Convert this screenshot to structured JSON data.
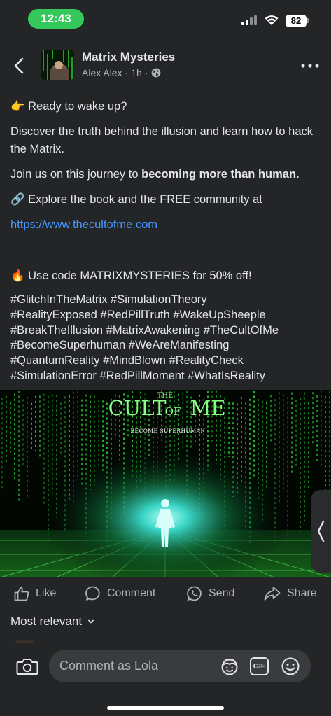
{
  "status_bar": {
    "time": "12:43",
    "battery": "82"
  },
  "header": {
    "page_name": "Matrix Mysteries",
    "author": "Alex Alex",
    "separator": "·",
    "age": "1h"
  },
  "post": {
    "wake_up": {
      "emoji": "👉",
      "text": "Ready to wake up?"
    },
    "discover": "Discover the truth behind the illusion and learn how to hack the Matrix.",
    "journey_prefix": "Join us on this journey to ",
    "journey_bold": "becoming more than human.",
    "explore": {
      "emoji": "🔗",
      "text": "Explore the book and the FREE community at"
    },
    "link": "https://www.thecultofme.com",
    "code": {
      "emoji": "🔥",
      "text": "Use code MATRIXMYSTERIES for 50% off!"
    },
    "hashtags": [
      "#GlitchInTheMatrix #SimulationTheory",
      "#RealityExposed #RedPillTruth #WakeUpSheeple",
      "#BreakTheIllusion #MatrixAwakening #TheCultOfMe",
      "#BecomeSuperhuman #WeAreManifesting",
      "#QuantumReality #MindBlown #RealityCheck",
      "#SimulationError #RedPillMoment #WhatIsReality"
    ]
  },
  "media": {
    "title_small": "THE",
    "title_cult": "CULT",
    "title_of": "OF",
    "title_me": "ME",
    "subtitle": "BECOME SUPERHUMAN",
    "accent_color": "#7dff7a"
  },
  "actions": {
    "like": "Like",
    "comment": "Comment",
    "send": "Send",
    "share": "Share"
  },
  "sort": {
    "label": "Most relevant"
  },
  "composer": {
    "placeholder": "Comment as Lola",
    "gif_label": "GIF"
  }
}
